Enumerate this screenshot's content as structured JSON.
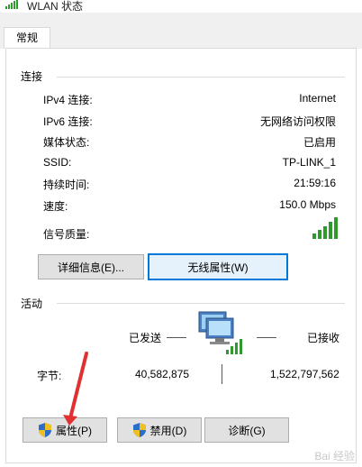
{
  "window": {
    "title": "WLAN 状态"
  },
  "tabs": [
    {
      "label": "常规"
    }
  ],
  "connection": {
    "section_title": "连接",
    "rows": [
      {
        "label": "IPv4 连接:",
        "value": "Internet"
      },
      {
        "label": "IPv6 连接:",
        "value": "无网络访问权限"
      },
      {
        "label": "媒体状态:",
        "value": "已启用"
      },
      {
        "label": "SSID:",
        "value": "TP-LINK_1"
      },
      {
        "label": "持续时间:",
        "value": "21:59:16"
      },
      {
        "label": "速度:",
        "value": "150.0 Mbps"
      }
    ],
    "signal_label": "信号质量:",
    "signal_bars": 5,
    "details_button": "详细信息(E)...",
    "wireless_props_button": "无线属性(W)"
  },
  "activity": {
    "section_title": "活动",
    "sent_label": "已发送",
    "received_label": "已接收",
    "bytes_label": "字节:",
    "bytes_sent": "40,582,875",
    "bytes_received": "1,522,797,562"
  },
  "buttons": {
    "properties": "属性(P)",
    "disable": "禁用(D)",
    "diagnose": "诊断(G)"
  },
  "watermark": "Bai 经验",
  "colors": {
    "accent": "#0078d7",
    "signal": "#2e9a2e",
    "annotation": "#e03030"
  }
}
